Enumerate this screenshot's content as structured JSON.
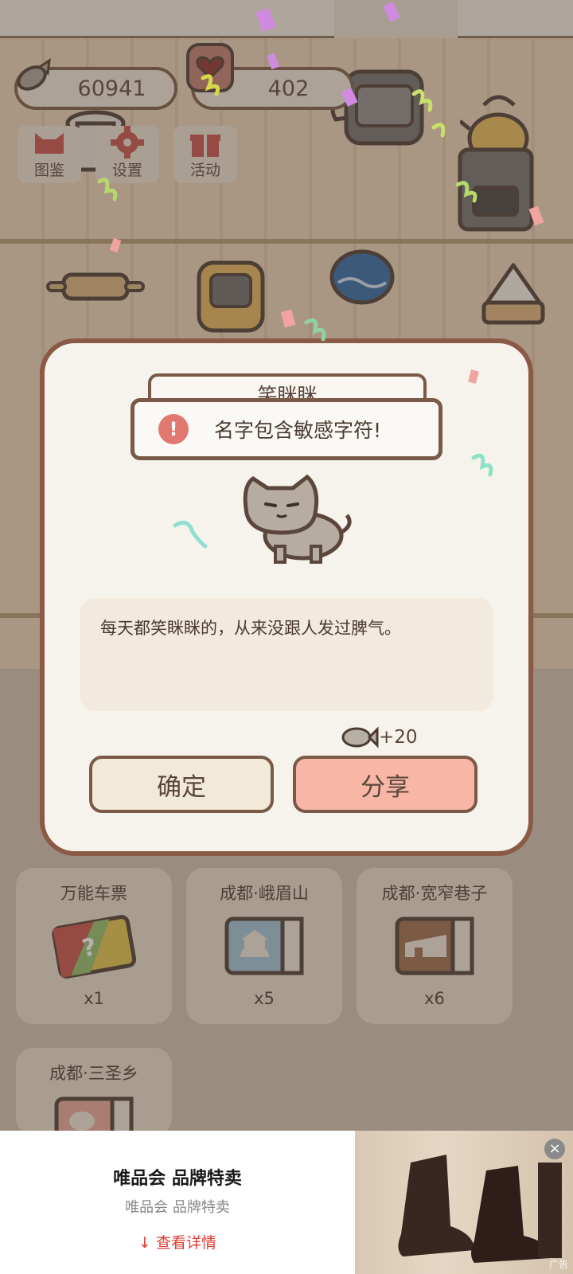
{
  "hud": {
    "fish_count": "60941",
    "heart_count": "402"
  },
  "menu": {
    "collection_label": "图鉴",
    "settings_label": "设置",
    "events_label": "活动"
  },
  "dialog": {
    "cat_name": "笑眯眯",
    "toast_message": "名字包含敏感字符!",
    "description": "每天都笑眯眯的，从来没跟人发过脾气。",
    "reward_text": "+20",
    "confirm_label": "确定",
    "share_label": "分享"
  },
  "tickets": [
    {
      "name": "万能车票",
      "count": "x1"
    },
    {
      "name": "成都·峨眉山",
      "count": "x5"
    },
    {
      "name": "成都·宽窄巷子",
      "count": "x6"
    },
    {
      "name": "成都·三圣乡",
      "count": ""
    }
  ],
  "ad": {
    "title": "唯品会 品牌特卖",
    "subtitle": "唯品会 品牌特卖",
    "cta": "查看详情",
    "tag": "广告"
  },
  "colors": {
    "accent_brown": "#7a5a47",
    "share_button": "#f7b6a6",
    "confirm_button": "#f2ead9",
    "warning": "#e2776f",
    "ad_cta": "#e23b33"
  }
}
